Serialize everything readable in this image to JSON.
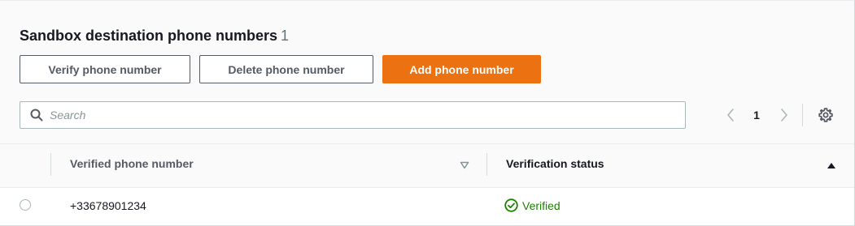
{
  "header": {
    "title": "Sandbox destination phone numbers",
    "count": "1"
  },
  "actions": {
    "verify_label": "Verify phone number",
    "delete_label": "Delete phone number",
    "add_label": "Add phone number"
  },
  "search": {
    "placeholder": "Search",
    "value": "",
    "icon": "search-icon"
  },
  "pagination": {
    "current_page": "1",
    "prev_icon": "chevron-left-icon",
    "next_icon": "chevron-right-icon",
    "settings_icon": "gear-icon"
  },
  "table": {
    "columns": [
      {
        "label": "Verified phone number",
        "sort_icon": "sort-down-icon"
      },
      {
        "label": "Verification status",
        "sort_icon": "sort-up-icon"
      }
    ],
    "rows": [
      {
        "phone": "+33678901234",
        "status": "Verified",
        "status_icon": "check-circle-icon",
        "selected": false
      }
    ]
  },
  "colors": {
    "primary": "#ec7211",
    "success": "#1d8102",
    "text": "#16191f",
    "muted": "#687078",
    "border": "#aab7b8"
  }
}
